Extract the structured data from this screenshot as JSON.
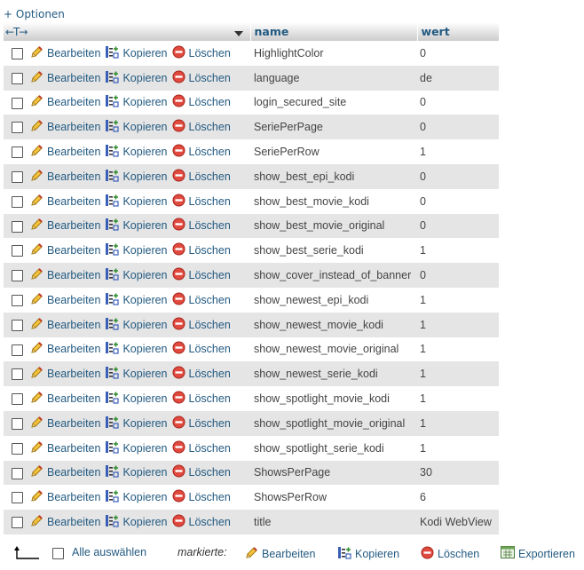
{
  "options_link": "+ Optionen",
  "header": {
    "arrows": "←T→",
    "name": "name",
    "wert": "wert"
  },
  "actions": {
    "edit": "Bearbeiten",
    "copy": "Kopieren",
    "delete": "Löschen"
  },
  "rows": [
    {
      "name": "HighlightColor",
      "wert": "0"
    },
    {
      "name": "language",
      "wert": "de"
    },
    {
      "name": "login_secured_site",
      "wert": "0"
    },
    {
      "name": "SeriePerPage",
      "wert": "0"
    },
    {
      "name": "SeriePerRow",
      "wert": "1"
    },
    {
      "name": "show_best_epi_kodi",
      "wert": "0"
    },
    {
      "name": "show_best_movie_kodi",
      "wert": "0"
    },
    {
      "name": "show_best_movie_original",
      "wert": "0"
    },
    {
      "name": "show_best_serie_kodi",
      "wert": "1"
    },
    {
      "name": "show_cover_instead_of_banner",
      "wert": "0"
    },
    {
      "name": "show_newest_epi_kodi",
      "wert": "1"
    },
    {
      "name": "show_newest_movie_kodi",
      "wert": "1"
    },
    {
      "name": "show_newest_movie_original",
      "wert": "1"
    },
    {
      "name": "show_newest_serie_kodi",
      "wert": "1"
    },
    {
      "name": "show_spotlight_movie_kodi",
      "wert": "1"
    },
    {
      "name": "show_spotlight_movie_original",
      "wert": "1"
    },
    {
      "name": "show_spotlight_serie_kodi",
      "wert": "1"
    },
    {
      "name": "ShowsPerPage",
      "wert": "30"
    },
    {
      "name": "ShowsPerRow",
      "wert": "6"
    },
    {
      "name": "title",
      "wert": "Kodi WebView"
    }
  ],
  "footer": {
    "select_all": "Alle auswählen",
    "marked": "markierte:",
    "edit": "Bearbeiten",
    "copy": "Kopieren",
    "delete": "Löschen",
    "export": "Exportieren"
  },
  "icons": {
    "edit": "pencil-icon",
    "copy": "copy-icon",
    "delete": "delete-icon",
    "export": "export-icon",
    "back_arrow": "arrow-up-left-icon"
  },
  "colors": {
    "link": "#235a81",
    "row_alt": "#e5e5e5",
    "delete_red": "#d9342b"
  }
}
